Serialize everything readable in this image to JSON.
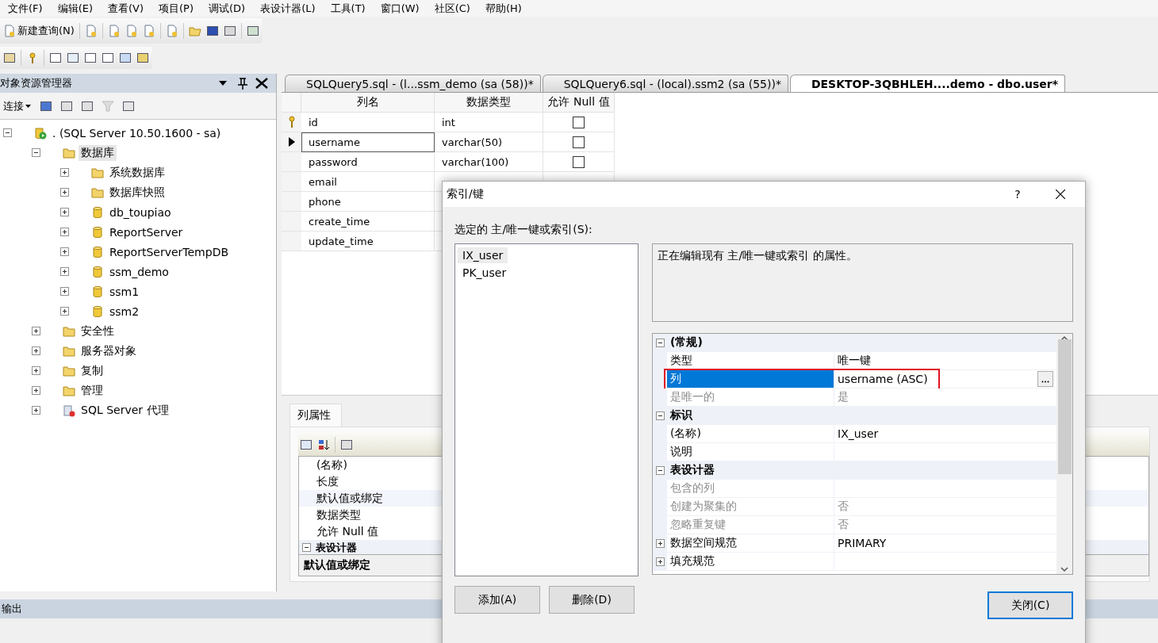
{
  "menu": [
    "文件(F)",
    "编辑(E)",
    "查看(V)",
    "项目(P)",
    "调试(D)",
    "表设计器(L)",
    "工具(T)",
    "窗口(W)",
    "社区(C)",
    "帮助(H)"
  ],
  "toolbar": {
    "new_query": "新建查询(N)"
  },
  "object_explorer": {
    "title": "对象资源管理器",
    "connect": "连接",
    "tree": [
      {
        "label": ". (SQL Server 10.50.1600 - sa)",
        "kind": "server",
        "expanded": true,
        "selected": false,
        "children": [
          {
            "label": "数据库",
            "kind": "folder",
            "expanded": true,
            "selected": true,
            "children": [
              {
                "label": "系统数据库",
                "kind": "folder",
                "expanded": false,
                "selected": false
              },
              {
                "label": "数据库快照",
                "kind": "folder",
                "expanded": false,
                "selected": false
              },
              {
                "label": "db_toupiao",
                "kind": "database",
                "expanded": false,
                "selected": false
              },
              {
                "label": "ReportServer",
                "kind": "database",
                "expanded": false,
                "selected": false
              },
              {
                "label": "ReportServerTempDB",
                "kind": "database",
                "expanded": false,
                "selected": false
              },
              {
                "label": "ssm_demo",
                "kind": "database",
                "expanded": false,
                "selected": false
              },
              {
                "label": "ssm1",
                "kind": "database",
                "expanded": false,
                "selected": false
              },
              {
                "label": "ssm2",
                "kind": "database",
                "expanded": false,
                "selected": false
              }
            ]
          },
          {
            "label": "安全性",
            "kind": "folder",
            "expanded": false,
            "selected": false
          },
          {
            "label": "服务器对象",
            "kind": "folder",
            "expanded": false,
            "selected": false
          },
          {
            "label": "复制",
            "kind": "folder",
            "expanded": false,
            "selected": false
          },
          {
            "label": "管理",
            "kind": "folder",
            "expanded": false,
            "selected": false
          },
          {
            "label": "SQL Server 代理",
            "kind": "agent",
            "expanded": false,
            "selected": false
          }
        ]
      }
    ]
  },
  "tabs": [
    {
      "label": "SQLQuery5.sql - (l...ssm_demo (sa (58))*",
      "selected": false
    },
    {
      "label": "SQLQuery6.sql - (local).ssm2 (sa (55))*",
      "selected": false
    },
    {
      "label": "DESKTOP-3QBHLEH....demo - dbo.user*",
      "selected": true
    }
  ],
  "table": {
    "columns": [
      "列名",
      "数据类型",
      "允许 Null 值"
    ],
    "rows": [
      {
        "name": "id",
        "type": "int",
        "allow_null": false,
        "primary_key": true,
        "current": false
      },
      {
        "name": "username",
        "type": "varchar(50)",
        "allow_null": false,
        "primary_key": false,
        "current": true
      },
      {
        "name": "password",
        "type": "varchar(100)",
        "allow_null": false,
        "primary_key": false,
        "current": false
      },
      {
        "name": "email",
        "primary_key": false,
        "current": false
      },
      {
        "name": "phone",
        "primary_key": false,
        "current": false
      },
      {
        "name": "create_time",
        "primary_key": false,
        "current": false
      },
      {
        "name": "update_time",
        "primary_key": false,
        "current": false
      }
    ]
  },
  "column_properties": {
    "tab": "列属性",
    "rows": [
      "(名称)",
      "长度",
      "默认值或绑定",
      "数据类型",
      "允许 Null 值"
    ],
    "category": "表设计器",
    "description": "默认值或绑定"
  },
  "dialog": {
    "title": "索引/键",
    "help": "?",
    "list_label": "选定的 主/唯一键或索引(S):",
    "items": [
      {
        "label": "IX_user",
        "selected": true
      },
      {
        "label": "PK_user",
        "selected": false
      }
    ],
    "description": "正在编辑现有 主/唯一键或索引 的属性。",
    "properties": [
      {
        "kind": "category",
        "label": "(常规)",
        "expanded": true
      },
      {
        "kind": "property",
        "label": "类型",
        "value": "唯一键",
        "disabled": false,
        "selected": false,
        "highlighted": false
      },
      {
        "kind": "property",
        "label": "列",
        "value": "username (ASC)",
        "disabled": false,
        "selected": true,
        "highlighted": true
      },
      {
        "kind": "property",
        "label": "是唯一的",
        "value": "是",
        "disabled": true,
        "selected": false,
        "highlighted": false
      },
      {
        "kind": "category",
        "label": "标识",
        "expanded": true
      },
      {
        "kind": "property",
        "label": "(名称)",
        "value": "IX_user",
        "disabled": false,
        "selected": false,
        "highlighted": false
      },
      {
        "kind": "property",
        "label": "说明",
        "disabled": false,
        "selected": false,
        "highlighted": false
      },
      {
        "kind": "category",
        "label": "表设计器",
        "expanded": true
      },
      {
        "kind": "property",
        "label": "包含的列",
        "disabled": true,
        "selected": false,
        "highlighted": false
      },
      {
        "kind": "property",
        "label": "创建为聚集的",
        "value": "否",
        "disabled": true,
        "selected": false,
        "highlighted": false
      },
      {
        "kind": "property",
        "label": "忽略重复键",
        "value": "否",
        "disabled": true,
        "selected": false,
        "highlighted": false
      },
      {
        "kind": "group",
        "label": "数据空间规范",
        "value": "PRIMARY",
        "expanded": false
      },
      {
        "kind": "group",
        "label": "填充规范",
        "expanded": false
      }
    ],
    "buttons": {
      "add": "添加(A)",
      "delete": "删除(D)",
      "close": "关闭(C)"
    }
  },
  "status_bar": {
    "title": "输出"
  }
}
